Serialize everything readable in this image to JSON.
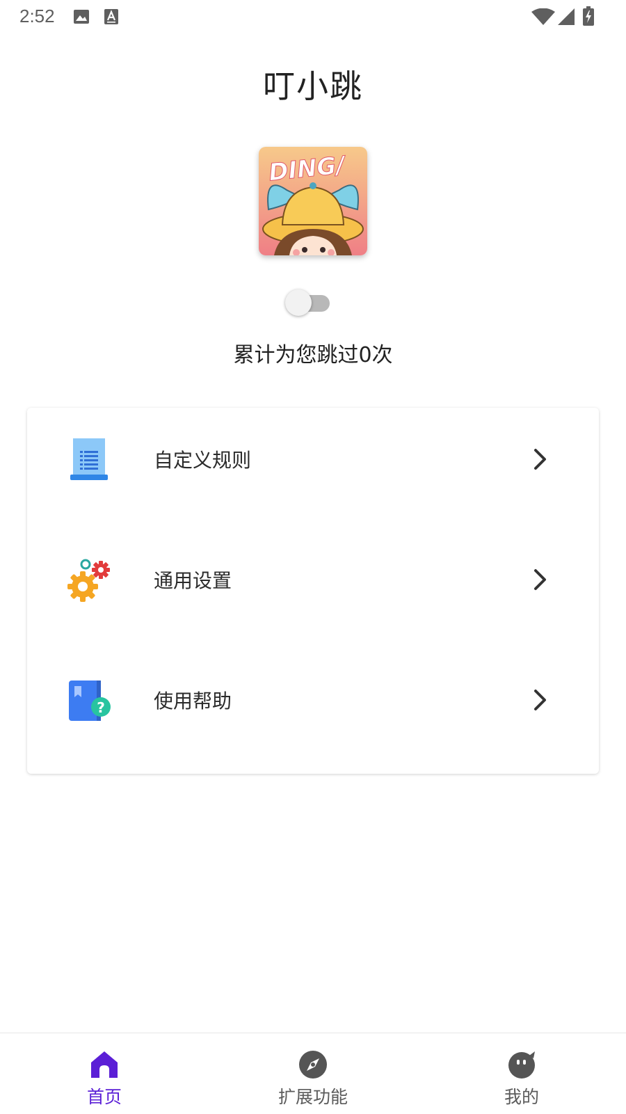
{
  "status_bar": {
    "time": "2:52",
    "left_icons": [
      "image-icon",
      "text-icon"
    ],
    "right_icons": [
      "wifi-icon",
      "cell-signal-icon",
      "battery-charging-icon"
    ]
  },
  "header": {
    "title": "叮小跳"
  },
  "logo": {
    "text": "DING/",
    "icon": "app-logo-icon"
  },
  "toggle": {
    "state": "off"
  },
  "stats": {
    "skip_text": "累计为您跳过0次"
  },
  "menu": {
    "items": [
      {
        "label": "自定义规则",
        "icon": "document-list-icon"
      },
      {
        "label": "通用设置",
        "icon": "gears-icon"
      },
      {
        "label": "使用帮助",
        "icon": "help-book-icon"
      }
    ]
  },
  "bottom_nav": {
    "items": [
      {
        "label": "首页",
        "icon": "home-icon",
        "active": true
      },
      {
        "label": "扩展功能",
        "icon": "compass-icon",
        "active": false
      },
      {
        "label": "我的",
        "icon": "profile-icon",
        "active": false
      }
    ]
  },
  "colors": {
    "accent": "#5b1fd6",
    "toggle_track_off": "#b8b8b8",
    "card_background": "#ffffff"
  }
}
